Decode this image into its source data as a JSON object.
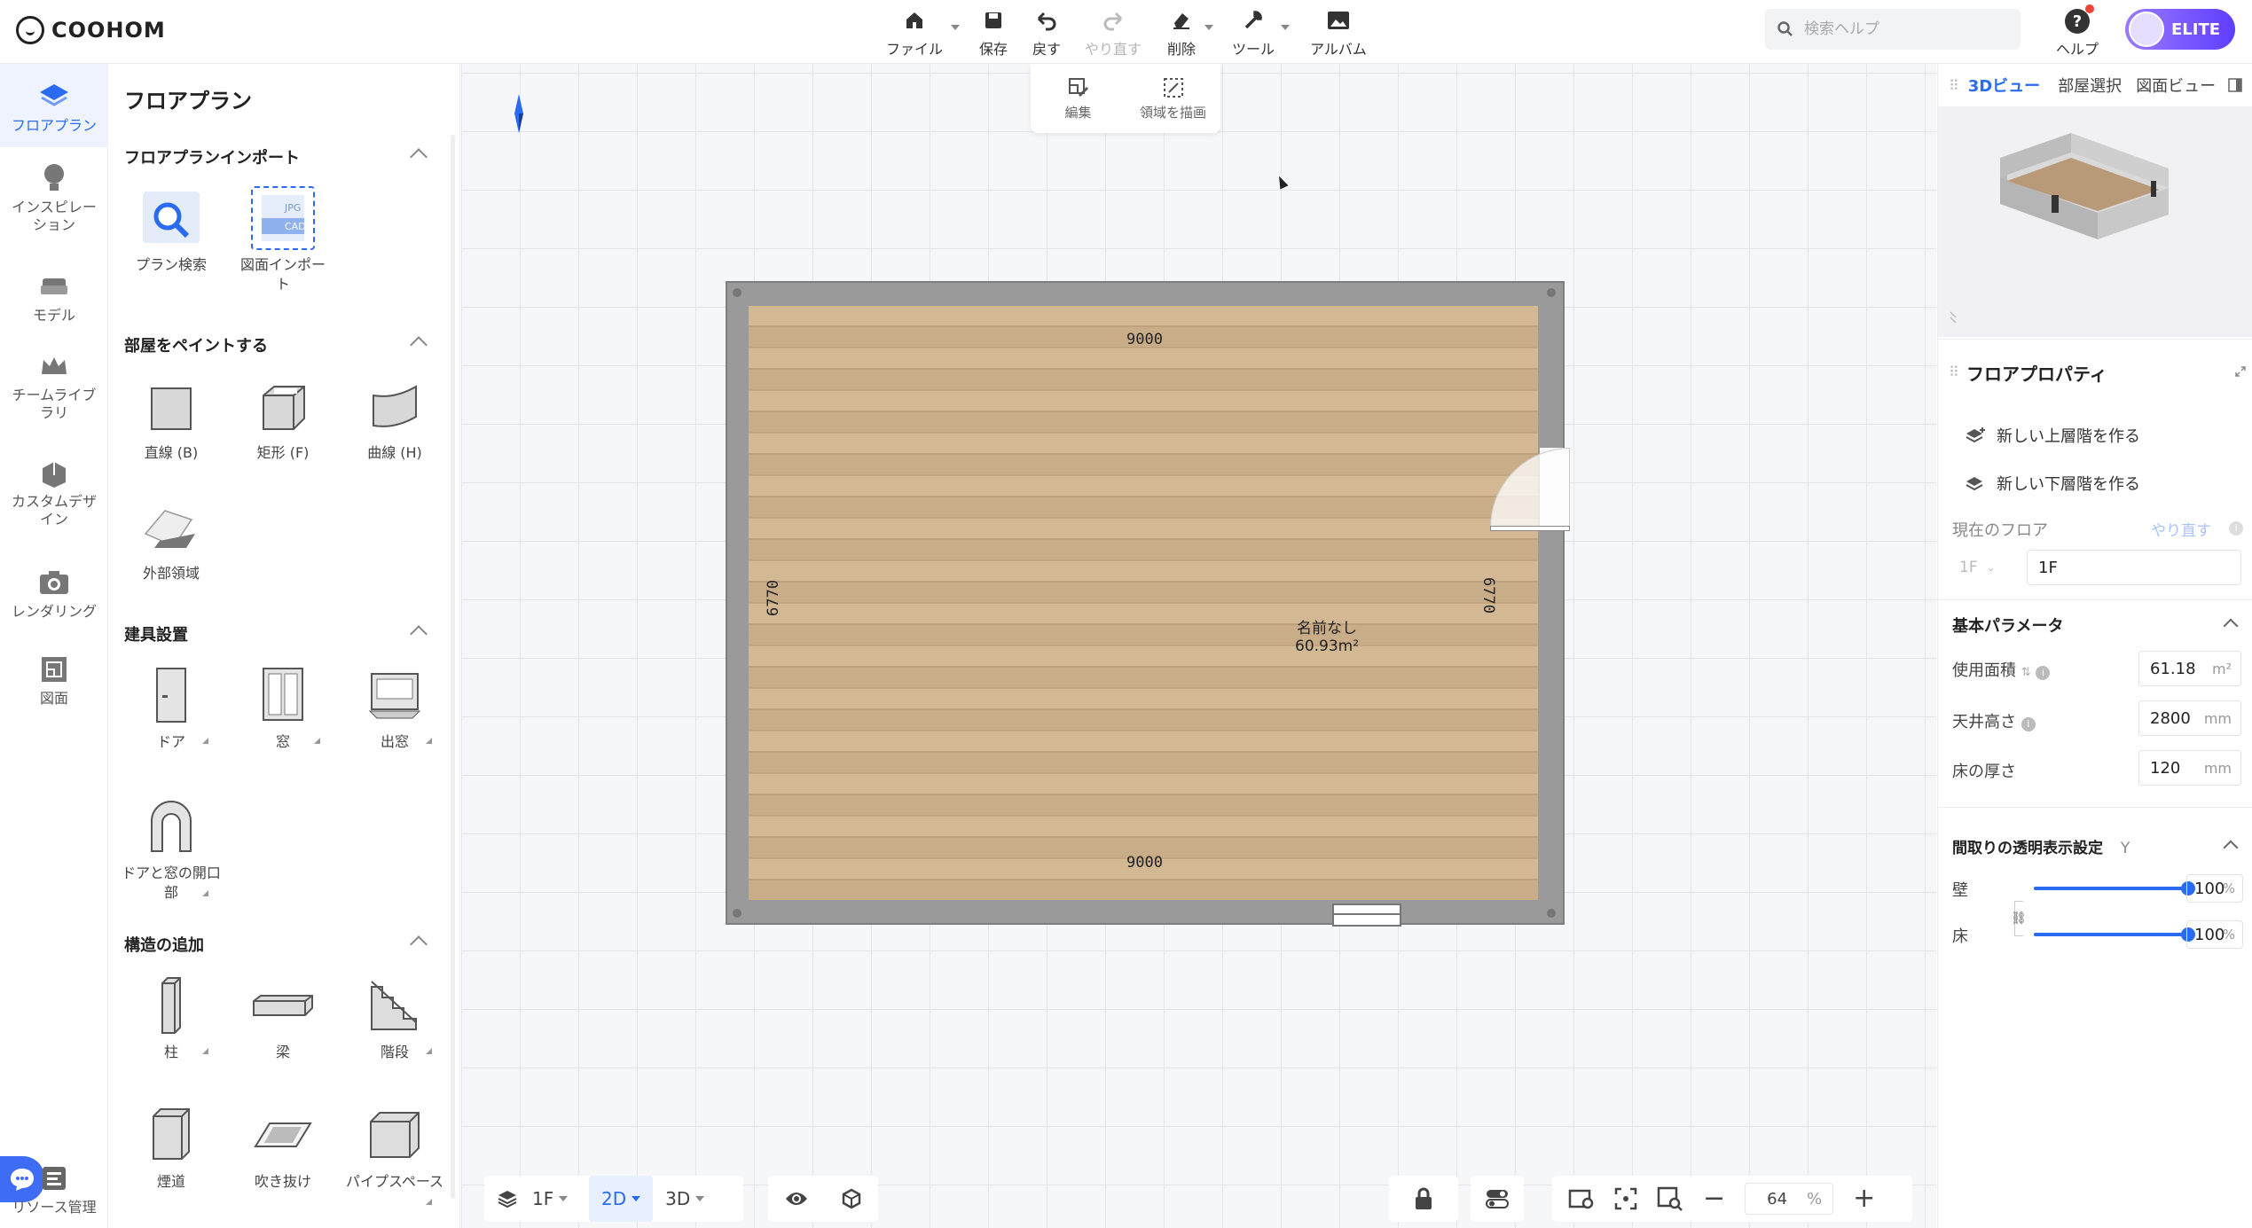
{
  "app": {
    "brand": "COOHOM",
    "plan_badge": "ELITE"
  },
  "toolbar": {
    "file": "ファイル",
    "save": "保存",
    "undo": "戻す",
    "redo": "やり直す",
    "delete": "削除",
    "tools": "ツール",
    "album": "アルバム",
    "search_placeholder": "検索ヘルプ",
    "help": "ヘルプ"
  },
  "sidebar": {
    "items": [
      {
        "label": "フロアプラン"
      },
      {
        "label": "インスピレーション"
      },
      {
        "label": "モデル"
      },
      {
        "label": "チームライブラリ"
      },
      {
        "label": "カスタムデザイン"
      },
      {
        "label": "レンダリング"
      },
      {
        "label": "図面"
      },
      {
        "label": "リソース管理"
      }
    ]
  },
  "catalog": {
    "title": "フロアプラン",
    "sections": [
      {
        "title": "フロアプランインポート",
        "items": [
          "プラン検索",
          "図面インポート"
        ]
      },
      {
        "title": "部屋をペイントする",
        "items": [
          "直線 (B)",
          "矩形 (F)",
          "曲線 (H)",
          "外部領域"
        ]
      },
      {
        "title": "建具設置",
        "items": [
          "ドア",
          "窓",
          "出窓",
          "ドアと窓の開口部"
        ]
      },
      {
        "title": "構造の追加",
        "items": [
          "柱",
          "梁",
          "階段",
          "煙道",
          "吹き抜け",
          "パイプスペース"
        ]
      }
    ],
    "cad_badges": [
      "JPG",
      "CAD"
    ]
  },
  "canvas": {
    "subtoolbar": {
      "edit": "編集",
      "draw_area": "領域を描画"
    },
    "room": {
      "name": "名前なし",
      "area": "60.93m²",
      "width_top": "9000",
      "width_bottom": "9000",
      "height_left": "6770",
      "height_right": "6770"
    },
    "bottom": {
      "floor": "1F",
      "view_2d": "2D",
      "view_3d": "3D",
      "zoom": "64",
      "zoom_unit": "%"
    }
  },
  "right_panel": {
    "tabs": [
      "3Dビュー",
      "部屋選択",
      "図面ビュー"
    ],
    "title": "フロアプロパティ",
    "new_upper": "新しい上層階を作る",
    "new_lower": "新しい下層階を作る",
    "current_floor_label": "現在のフロア",
    "current_floor_redo": "やり直す",
    "floor_code": "1F",
    "floor_name": "1F",
    "basic_params": "基本パラメータ",
    "area_label": "使用面積",
    "area_value": "61.18",
    "area_unit": "m²",
    "ceiling_label": "天井高さ",
    "ceiling_value": "2800",
    "ceiling_unit": "mm",
    "floor_thick_label": "床の厚さ",
    "floor_thick_value": "120",
    "floor_thick_unit": "mm",
    "transparency_title": "間取りの透明表示設定",
    "transparency_key": "Y",
    "wall_label": "壁",
    "wall_value": "100",
    "floor_label": "床",
    "floor_value": "100",
    "pct_unit": "%"
  },
  "colors": {
    "accent": "#2a6bf2",
    "brand_purple": "#6a4cff"
  }
}
